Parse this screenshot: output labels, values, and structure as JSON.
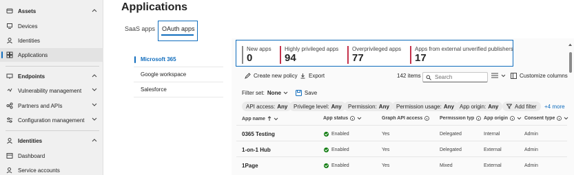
{
  "nav": {
    "items": [
      {
        "label": "Assets",
        "icon": "assets-icon",
        "section": true,
        "expanded": true
      },
      {
        "label": "Devices",
        "icon": "devices-icon"
      },
      {
        "label": "Identities",
        "icon": "identities-icon"
      },
      {
        "label": "Applications",
        "icon": "applications-icon",
        "active": true
      },
      {
        "label": "Endpoints",
        "icon": "endpoints-icon",
        "section": true,
        "expanded": true
      },
      {
        "label": "Vulnerability management",
        "icon": "vulnerability-icon",
        "collapsed": true
      },
      {
        "label": "Partners and APIs",
        "icon": "partners-icon",
        "collapsed": true
      },
      {
        "label": "Configuration management",
        "icon": "configuration-icon",
        "collapsed": true
      },
      {
        "label": "Identities",
        "icon": "identities-section-icon",
        "section": true,
        "expanded": true
      },
      {
        "label": "Dashboard",
        "icon": "dashboard-icon"
      },
      {
        "label": "Service accounts",
        "icon": "service-accounts-icon"
      }
    ]
  },
  "page": {
    "title": "Applications"
  },
  "tabs": [
    {
      "label": "SaaS apps",
      "active": false
    },
    {
      "label": "OAuth apps",
      "active": true
    }
  ],
  "subnav": [
    {
      "label": "Microsoft 365",
      "active": true
    },
    {
      "label": "Google workspace",
      "active": false
    },
    {
      "label": "Salesforce",
      "active": false
    }
  ],
  "stats": [
    {
      "label": "New apps",
      "value": "0",
      "color": "#8a8a8a"
    },
    {
      "label": "Highly privileged apps",
      "value": "94",
      "color": "#c4314b"
    },
    {
      "label": "Overprivileged apps",
      "value": "77",
      "color": "#c4314b"
    },
    {
      "label": "Apps from external unverified publishers",
      "value": "17",
      "color": "#c4314b"
    }
  ],
  "toolbar": {
    "create_policy": "Create new policy",
    "export": "Export",
    "items_count": "142 items",
    "search_placeholder": "Search",
    "customize_columns": "Customize columns"
  },
  "filters": {
    "filter_set_label": "Filter set:",
    "filter_set_value": "None",
    "save": "Save",
    "chips": [
      {
        "label": "API access:",
        "value": "Any"
      },
      {
        "label": "Privilege level:",
        "value": "Any"
      },
      {
        "label": "Permission:",
        "value": "Any"
      },
      {
        "label": "Permission usage:",
        "value": "Any"
      },
      {
        "label": "App origin:",
        "value": "Any"
      },
      {
        "label": "Add filter",
        "value": ""
      }
    ],
    "more": "+4 more"
  },
  "table": {
    "columns": [
      "App name",
      "App status",
      "Graph API access",
      "Permission type",
      "App origin",
      "Consent type"
    ],
    "rows": [
      {
        "name": "0365 Testing",
        "status": "Enabled",
        "graph": "Yes",
        "perm": "Delegated",
        "origin": "Internal",
        "consent": "Admin"
      },
      {
        "name": "1-on-1 Hub",
        "status": "Enabled",
        "graph": "Yes",
        "perm": "Delegated",
        "origin": "External",
        "consent": "Admin"
      },
      {
        "name": "1Page",
        "status": "Enabled",
        "graph": "Yes",
        "perm": "Mixed",
        "origin": "External",
        "consent": "Admin"
      }
    ]
  },
  "colors": {
    "accent": "#0f6cbd",
    "status_ok": "#107c10",
    "alert": "#c4314b"
  }
}
